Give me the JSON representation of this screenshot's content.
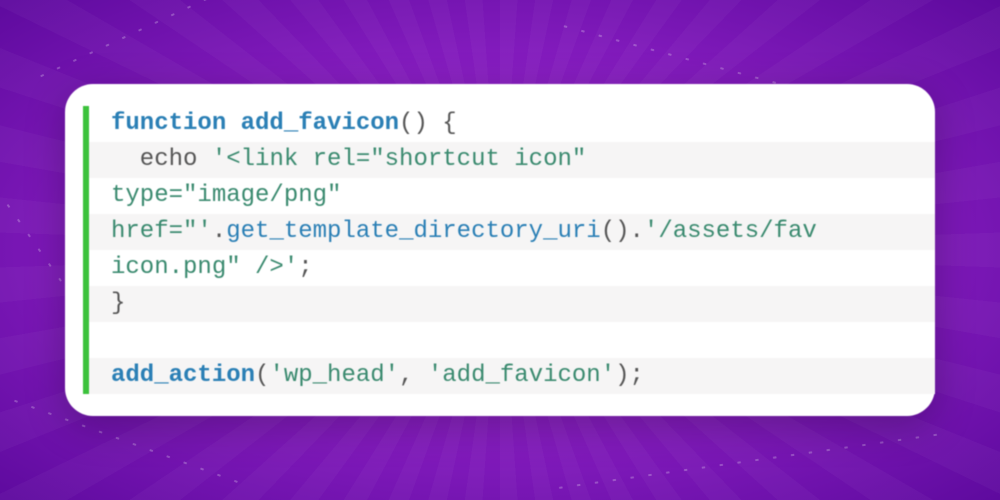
{
  "code": {
    "l1_kw": "function",
    "l1_fn": " add_favicon",
    "l1_rest": "() {",
    "l2_pre": "  echo ",
    "l2_str": "'<link rel=\"shortcut icon\" ",
    "l3_str": "type=\"image/png\" ",
    "l4_str_a": "href=\"'",
    "l4_op": ".",
    "l4_call": "get_template_directory_uri",
    "l4_rest": "().",
    "l4_str_b": "'/assets/fav",
    "l5_str": "icon.png\" />'",
    "l5_end": ";",
    "l6": "}",
    "l7": " ",
    "l8_fn": "add_action",
    "l8_paren": "(",
    "l8_arg1": "'wp_head'",
    "l8_comma": ", ",
    "l8_arg2": "'add_favicon'",
    "l8_end": ");"
  }
}
